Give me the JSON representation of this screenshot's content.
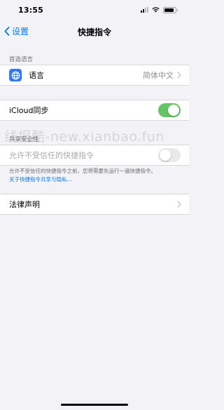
{
  "status_bar": {
    "time": "13:55"
  },
  "nav": {
    "back_label": "设置",
    "title": "快捷指令"
  },
  "preferred_language": {
    "header": "首选语言",
    "label": "语言",
    "value": "简体中文",
    "icon": "globe-icon"
  },
  "icloud_sync": {
    "label": "iCloud同步",
    "state": "on"
  },
  "sharing_security": {
    "header": "共享安全性",
    "label": "允许不受信任的快捷指令",
    "state": "off",
    "footer": "允许不受信任的快捷指令之前，您将需要先运行一遍快捷指令。",
    "link": "关于快捷指令共享与隐私..."
  },
  "legal": {
    "label": "法律声明"
  },
  "watermark": "线报酷-new.xianbao.fun",
  "colors": {
    "accent": "#007aff",
    "toggle_on": "#65c466",
    "background": "#f2f2f7"
  }
}
